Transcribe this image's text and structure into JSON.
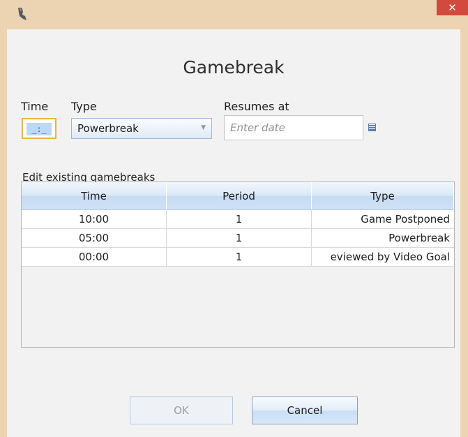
{
  "window": {
    "close_glyph": "✕",
    "icon": "app-quill-icon"
  },
  "dialog": {
    "title": "Gamebreak"
  },
  "form": {
    "time_label": "Time",
    "time_value": "_:_",
    "type_label": "Type",
    "type_value": "Powerbreak",
    "resumes_label": "Resumes at",
    "resumes_placeholder": "Enter date"
  },
  "section": {
    "label": "Edit existing gamebreaks"
  },
  "grid": {
    "columns": [
      "Time",
      "Period",
      "Type"
    ],
    "rows": [
      {
        "time": "10:00",
        "period": "1",
        "type": "Game Postponed"
      },
      {
        "time": "05:00",
        "period": "1",
        "type": "Powerbreak"
      },
      {
        "time": "00:00",
        "period": "1",
        "type": "eviewed by Video Goal"
      }
    ]
  },
  "buttons": {
    "ok": "OK",
    "cancel": "Cancel"
  },
  "colors": {
    "titlebar": "#ecd3b1",
    "close": "#d2493d",
    "header": "#dbe9f8"
  }
}
